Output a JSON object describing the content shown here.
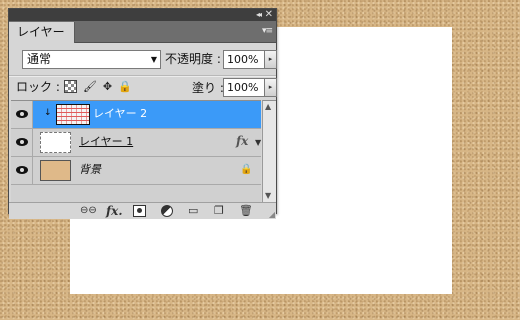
{
  "panel": {
    "tab_label": "レイヤー",
    "collapse_glyph": "◂◂",
    "close_glyph": "✕",
    "menu_glyph": "▾≡"
  },
  "blend": {
    "mode_value": "通常",
    "dropdown_glyph": "▼"
  },
  "opacity": {
    "label": "不透明度 :",
    "value": "100%",
    "stepper_glyph": "▸"
  },
  "lock": {
    "label": "ロック :",
    "paint_glyph": "🖌",
    "move_glyph": "✥",
    "all_glyph": "🔒"
  },
  "fill": {
    "label": "塗り :",
    "value": "100%",
    "stepper_glyph": "▸"
  },
  "layers": [
    {
      "name": "レイヤー 2",
      "selected": true,
      "visible": true,
      "clipping": true
    },
    {
      "name": "レイヤー 1",
      "selected": false,
      "visible": true,
      "has_effects": true
    },
    {
      "name": "背景",
      "selected": false,
      "visible": true,
      "locked": true
    }
  ],
  "layer_glyphs": {
    "clip_arrow": "↓",
    "fx": "fx",
    "fx_expand": "▼",
    "bg_lock": "🔒"
  },
  "scrollbar": {
    "up_glyph": "▲",
    "down_glyph": "▼"
  },
  "bottom_bar": {
    "link_glyph": "⊖⊖",
    "style_glyph": "fx.",
    "group_glyph": "▭",
    "new_layer_glyph": "❐",
    "delete_glyph": "🗑",
    "grip_glyph": "◢"
  },
  "colors": {
    "selected_row": "#3b9af8",
    "panel_bg": "#d6d6d6",
    "titlebar": "#3e3e3e",
    "canvas_bg": "#d7b686",
    "background_thumb": "#dfb989"
  }
}
